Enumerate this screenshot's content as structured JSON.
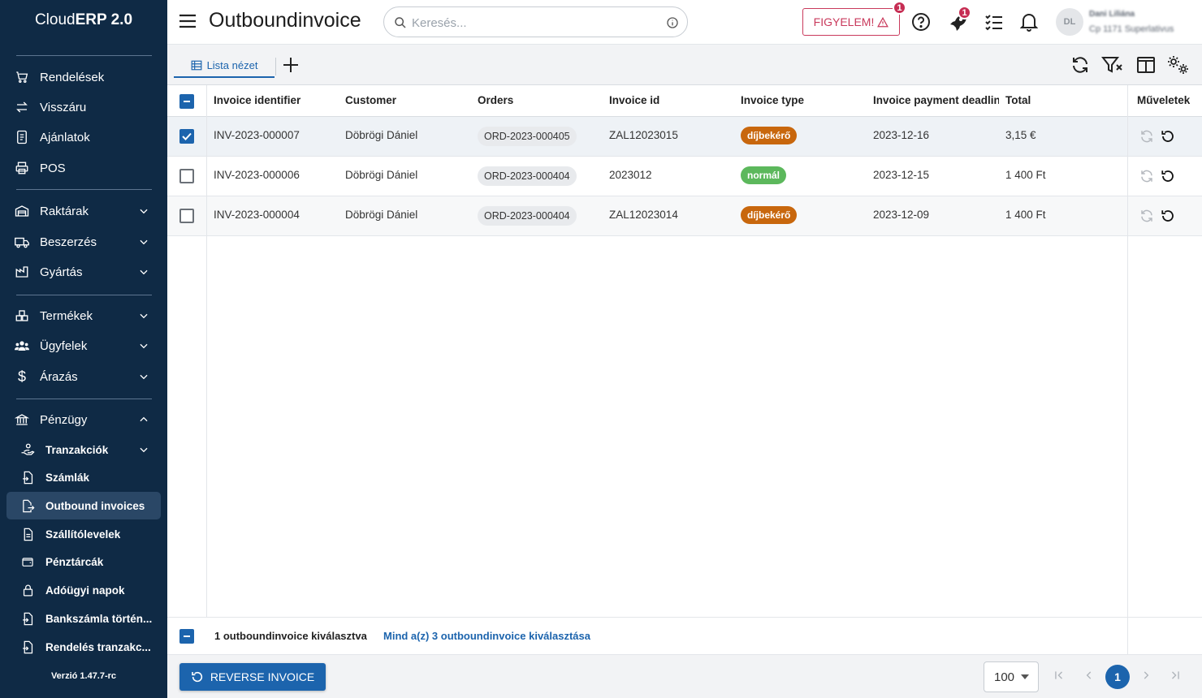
{
  "app": {
    "brand_light": "Cloud",
    "brand_bold": "ERP 2.0",
    "version": "Verzió 1.47.7-rc"
  },
  "sidebar": {
    "items": [
      {
        "label": "Rendelések",
        "icon": "cart-icon"
      },
      {
        "label": "Visszáru",
        "icon": "swap-arrows-icon"
      },
      {
        "label": "Ajánlatok",
        "icon": "document-icon"
      },
      {
        "label": "POS",
        "icon": "printer-icon"
      },
      {
        "label": "Raktárak",
        "icon": "warehouse-icon"
      },
      {
        "label": "Beszerzés",
        "icon": "truck-icon"
      },
      {
        "label": "Gyártás",
        "icon": "factory-icon"
      },
      {
        "label": "Termékek",
        "icon": "boxes-icon"
      },
      {
        "label": "Ügyfelek",
        "icon": "users-icon"
      },
      {
        "label": "Árazás",
        "icon": "dollar-icon"
      },
      {
        "label": "Pénzügy",
        "icon": "bank-icon"
      }
    ],
    "sub_items": [
      {
        "label": "Tranzakciók",
        "icon": "hand-coin-icon"
      },
      {
        "label": "Számlák",
        "icon": "file-import-icon"
      },
      {
        "label": "Outbound invoices",
        "icon": "file-export-icon"
      },
      {
        "label": "Szállítólevelek",
        "icon": "file-icon"
      },
      {
        "label": "Pénztárcák",
        "icon": "wallet-icon"
      },
      {
        "label": "Adóügyi napok",
        "icon": "lock-icon"
      },
      {
        "label": "Bankszámla történ...",
        "icon": "file-import-icon"
      },
      {
        "label": "Rendelés tranzakc...",
        "icon": "file-import-icon"
      }
    ]
  },
  "header": {
    "title": "Outboundinvoice",
    "search_placeholder": "Keresés...",
    "alert_label": "FIGYELEM!",
    "alert_badge": "1",
    "rocket_badge": "1",
    "avatar_initials": "DL",
    "user_name": "Dani Liliána",
    "user_sub": "Cp 1171 Superlativus"
  },
  "toolbar": {
    "tab_label": "Lista nézet"
  },
  "table": {
    "columns": [
      "Invoice identifier",
      "Customer",
      "Orders",
      "Invoice id",
      "Invoice type",
      "Invoice payment deadline",
      "Total",
      "Műveletek"
    ],
    "rows": [
      {
        "identifier": "INV-2023-000007",
        "customer": "Döbrögi Dániel",
        "order": "ORD-2023-000405",
        "invoice_id": "ZAL12023015",
        "type": "díjbekérő",
        "deadline": "2023-12-16",
        "total": "3,15 €",
        "selected": true
      },
      {
        "identifier": "INV-2023-000006",
        "customer": "Döbrögi Dániel",
        "order": "ORD-2023-000404",
        "invoice_id": "2023012",
        "type": "normál",
        "deadline": "2023-12-15",
        "total": "1 400 Ft",
        "selected": false
      },
      {
        "identifier": "INV-2023-000004",
        "customer": "Döbrögi Dániel",
        "order": "ORD-2023-000404",
        "invoice_id": "ZAL12023014",
        "type": "díjbekérő",
        "deadline": "2023-12-09",
        "total": "1 400 Ft",
        "selected": false
      }
    ]
  },
  "selection": {
    "selected_text": "1 outboundinvoice kiválasztva",
    "select_all_text": "Mind a(z) 3 outboundinvoice kiválasztása"
  },
  "footer": {
    "reverse_label": "REVERSE INVOICE",
    "page_size": "100",
    "current_page": "1"
  },
  "colors": {
    "sidebar": "#0f2a45",
    "accent": "#1c64ad",
    "proforma": "#c8670d",
    "normal": "#5cb85c",
    "alert": "#c93a5c"
  }
}
